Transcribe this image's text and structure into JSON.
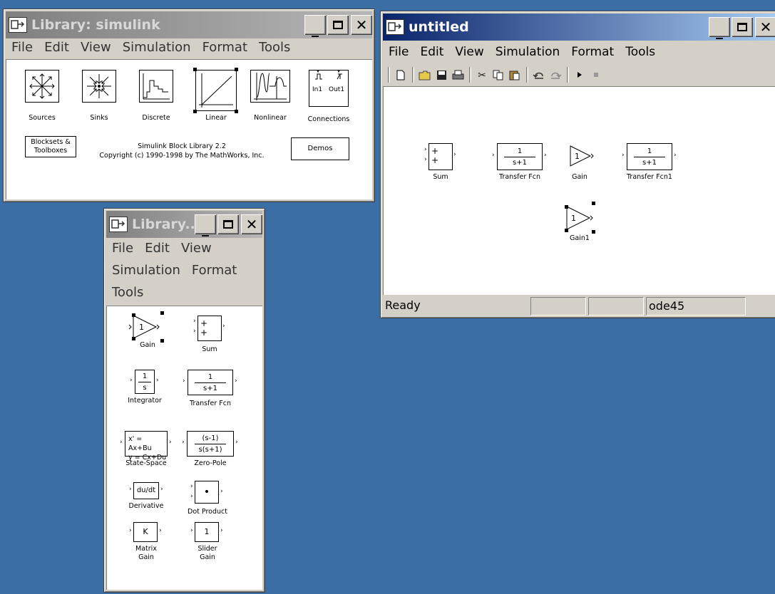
{
  "lib_window": {
    "title": "Library: simulink",
    "menu": [
      "File",
      "Edit",
      "View",
      "Simulation",
      "Format",
      "Tools"
    ],
    "icons": [
      {
        "label": "Sources",
        "icon": "sources-icon"
      },
      {
        "label": "Sinks",
        "icon": "sinks-icon"
      },
      {
        "label": "Discrete",
        "icon": "discrete-icon"
      },
      {
        "label": "Linear",
        "icon": "linear-icon"
      },
      {
        "label": "Nonlinear",
        "icon": "nonlinear-icon"
      },
      {
        "label": "Connections",
        "icon": "connections-icon"
      }
    ],
    "blocksets_line1": "Blocksets &",
    "blocksets_line2": "Toolboxes",
    "info_line1": "Simulink Block Library 2.2",
    "info_line2": "Copyright (c) 1990-1998 by The MathWorks, Inc.",
    "demos": "Demos",
    "port_in": "In1",
    "port_out": "Out1"
  },
  "sub_window": {
    "title": "Library...",
    "menu": [
      "File",
      "Edit",
      "View",
      "Simulation",
      "Format",
      "Tools"
    ],
    "blocks": {
      "gain": {
        "label": "Gain",
        "content": "1"
      },
      "sum": {
        "label": "Sum",
        "plus1": "+",
        "plus2": "+"
      },
      "integrator": {
        "label": "Integrator",
        "num": "1",
        "den": "s"
      },
      "transfer": {
        "label": "Transfer Fcn",
        "num": "1",
        "den": "s+1"
      },
      "statespace": {
        "label": "State-Space",
        "line1": "x' = Ax+Bu",
        "line2": "y = Cx+Du"
      },
      "zeropole": {
        "label": "Zero-Pole",
        "num": "(s-1)",
        "den": "s(s+1)"
      },
      "derivative": {
        "label": "Derivative",
        "content": "du/dt"
      },
      "dotproduct": {
        "label": "Dot Product",
        "content": "•"
      },
      "matrixgain": {
        "label1": "Matrix",
        "label2": "Gain",
        "content": "K"
      },
      "slidergain": {
        "label1": "Slider",
        "label2": "Gain",
        "content": "1"
      }
    }
  },
  "model_window": {
    "title": "untitled",
    "menu": [
      "File",
      "Edit",
      "View",
      "Simulation",
      "Format",
      "Tools"
    ],
    "blocks": {
      "sum": {
        "label": "Sum",
        "plus1": "+",
        "plus2": "+"
      },
      "tf1": {
        "label": "Transfer Fcn",
        "num": "1",
        "den": "s+1"
      },
      "gain": {
        "label": "Gain",
        "content": "1"
      },
      "tf2": {
        "label": "Transfer Fcn1",
        "num": "1",
        "den": "s+1"
      },
      "gain1": {
        "label": "Gain1",
        "content": "1"
      }
    },
    "status": {
      "ready": "Ready",
      "solver": "ode45"
    }
  }
}
